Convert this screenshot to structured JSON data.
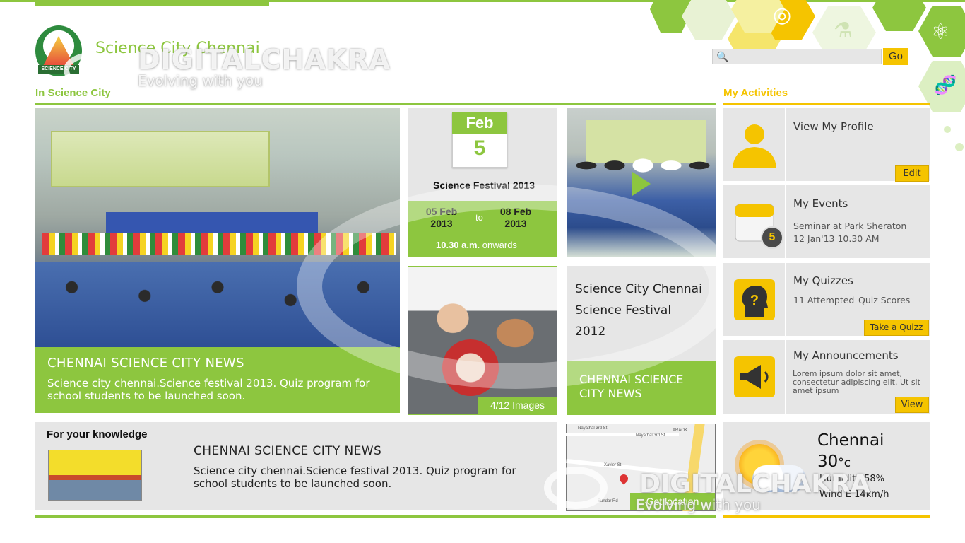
{
  "site": {
    "title": "Science City Chennai",
    "logo_text": "SCIENCE CITY"
  },
  "watermark": {
    "name": "DIGITALCHAKRA",
    "tagline": "Evolving with you"
  },
  "search": {
    "placeholder": "",
    "button": "Go"
  },
  "sections": {
    "in_science_city": "In Science City",
    "my_activities": "My Activities"
  },
  "main_news": {
    "title": "CHENNAI SCIENCE CITY NEWS",
    "body": "Science city chennai.Science festival 2013. Quiz program for school students to be launched soon."
  },
  "event": {
    "month": "Feb",
    "day": "5",
    "title": "Science Festival 2013",
    "from": "05 Feb 2013",
    "to_label": "to",
    "to": "08 Feb 2013",
    "time": "10.30 a.m.",
    "time_suffix": "onwards"
  },
  "gallery": {
    "caption": "4/12 Images"
  },
  "article": {
    "line1": "Science City Chennai",
    "line2": "Science Festival",
    "line3": "2012",
    "news": "CHENNAI SCIENCE CITY NEWS"
  },
  "activities": {
    "profile": {
      "title": "View My Profile",
      "button": "Edit"
    },
    "events": {
      "title": "My Events",
      "badge": "5",
      "line1": "Seminar at Park Sheraton",
      "line2": "12 Jan'13 10.30 AM"
    },
    "quizzes": {
      "title": "My Quizzes",
      "attempted": "11 Attempted",
      "scores": "Quiz Scores",
      "button": "Take a Quizz"
    },
    "announcements": {
      "title": "My Announcements",
      "body": "Lorem ipsum dolor sit amet, consectetur adipiscing elit. Ut sit amet ipsum",
      "button": "View"
    }
  },
  "knowledge": {
    "heading": "For your knowledge",
    "title": "CHENNAI SCIENCE CITY NEWS",
    "body": "Science city chennai.Science festival 2013. Quiz program for school students to be launched soon."
  },
  "map": {
    "button": "Get location",
    "labels": [
      "Nayathal 3rd St",
      "Nayathal 3rd St",
      "Xavier St",
      "Sundar Rd",
      "ARAOK"
    ]
  },
  "weather": {
    "city": "Chennai",
    "temp": "30",
    "unit": "°c",
    "humidity": "Humidity 58%",
    "wind": "Wind E 14km/h"
  },
  "colors": {
    "green": "#8dc63f",
    "yellow": "#f5c400",
    "tile": "#e6e6e6"
  }
}
